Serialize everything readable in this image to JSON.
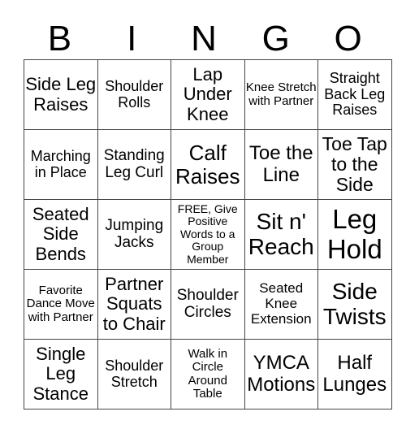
{
  "header": {
    "letters": [
      "B",
      "I",
      "N",
      "G",
      "O"
    ]
  },
  "board": {
    "rows": [
      [
        "Side Leg Raises",
        "Shoulder Rolls",
        "Lap Under Knee",
        "Knee Stretch with Partner",
        "Straight Back Leg Raises"
      ],
      [
        "Marching in Place",
        "Standing Leg Curl",
        "Calf Raises",
        "Toe the Line",
        "Toe Tap to the Side"
      ],
      [
        "Seated Side Bends",
        "Jumping Jacks",
        "FREE, Give Positive Words to a Group Member",
        "Sit n' Reach",
        "Leg Hold"
      ],
      [
        "Favorite Dance Move with Partner",
        "Partner Squats to Chair",
        "Shoulder Circles",
        "Seated Knee Extension",
        "Side Twists"
      ],
      [
        "Single Leg Stance",
        "Shoulder Stretch",
        "Walk in Circle Around Table",
        "YMCA Motions",
        "Half Lunges"
      ]
    ]
  }
}
